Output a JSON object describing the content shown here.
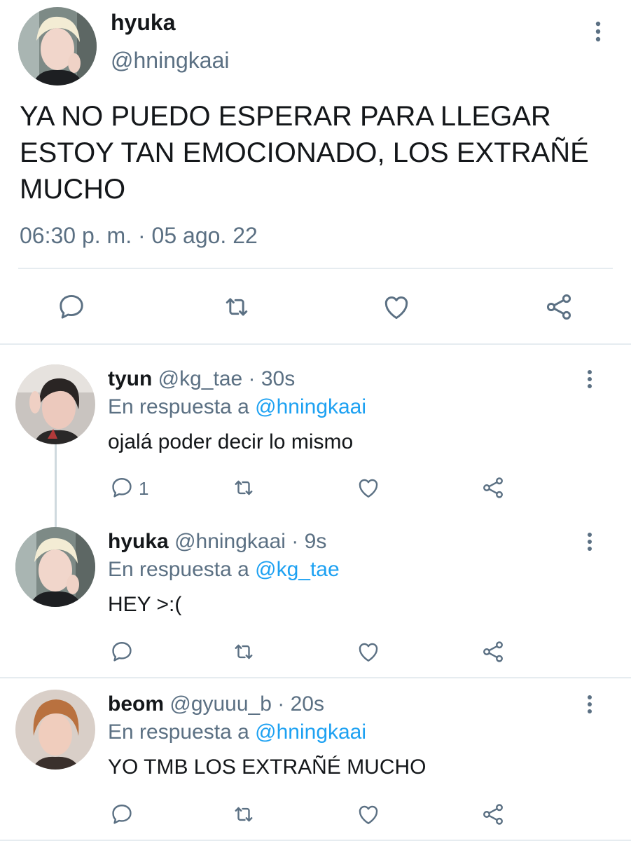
{
  "main_tweet": {
    "display_name": "hyuka",
    "handle": "@hningkaai",
    "text": "YA NO PUEDO ESPERAR PARA LLEGAR ESTOY TAN EMOCIONADO, LOS EXTRAÑÉ MUCHO",
    "timestamp": "06:30 p. m. · 05 ago. 22",
    "actions": [
      "reply-icon",
      "retweet-icon",
      "like-icon",
      "share-icon"
    ]
  },
  "replies": [
    {
      "display_name": "tyun",
      "handle": "@kg_tae",
      "time": "30s",
      "reply_prefix": "En respuesta a",
      "reply_to": "@hningkaai",
      "text": "ojalá poder decir lo mismo",
      "reply_count": "1"
    },
    {
      "display_name": "hyuka",
      "handle": "@hningkaai",
      "time": "9s",
      "reply_prefix": "En respuesta a",
      "reply_to": "@kg_tae",
      "text": "HEY >:(",
      "reply_count": ""
    },
    {
      "display_name": "beom",
      "handle": "@gyuuu_b",
      "time": "20s",
      "reply_prefix": "En respuesta a",
      "reply_to": "@hningkaai",
      "text": "YO TMB LOS EXTRAÑÉ MUCHO",
      "reply_count": ""
    }
  ],
  "separator": " · ",
  "colors": {
    "text_primary": "#14171a",
    "text_secondary": "#5b7083",
    "link": "#1da1f2",
    "divider": "#e6ecf0"
  }
}
